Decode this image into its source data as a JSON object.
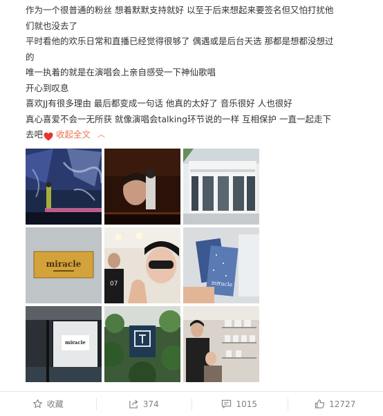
{
  "post": {
    "lines": [
      "作为一个很普通的粉丝 想着默默支持就好 以至于后来想起来要签名但又怕打扰他",
      "们就也没去了",
      "平时看他的欢乐日常和直播已经觉得很够了 偶遇或是后台天选 那都是想都没想过",
      "的",
      "唯一执着的就是在演唱会上亲自感受一下神仙歌唱",
      "开心到叹息",
      "喜欢JJ有很多理由 最后都变成一句话 他真的太好了 音乐很好 人也很好",
      "真心喜爱不会一无所获 就像演唱会talking环节说的一样 互相保护 一直一起走下"
    ],
    "last_line": "去吧",
    "collapse_label": "收起全文"
  },
  "photos": {
    "sign_text": "miracle",
    "jersey_number": "07"
  },
  "actions": {
    "favorite_label": "收藏",
    "repost_count": "374",
    "comment_count": "1015",
    "like_count": "12727"
  },
  "colors": {
    "accent": "#eb7350",
    "heart": "#e8332e",
    "icon": "#808080"
  }
}
